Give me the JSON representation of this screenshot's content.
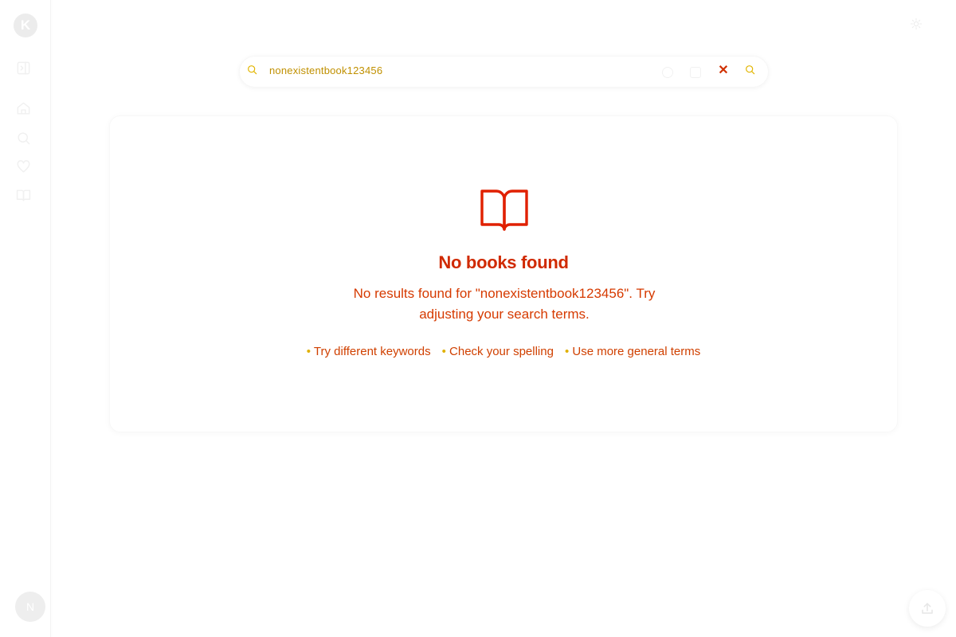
{
  "sidebar": {
    "logo_letter": "K",
    "items": [
      {
        "icon": "collapse-sidebar-icon"
      },
      {
        "icon": "home-icon"
      },
      {
        "icon": "search-icon"
      },
      {
        "icon": "heart-icon"
      },
      {
        "icon": "book-open-icon"
      }
    ],
    "avatar_letter": "N"
  },
  "header": {
    "theme_icon": "sun-icon"
  },
  "search": {
    "query": "nonexistentbook123456",
    "left_icon": "search-icon",
    "right_icon": "search-icon",
    "clear_symbol": "✕"
  },
  "empty_state": {
    "icon": "book-open-icon",
    "title": "No books found",
    "message": "No results found for \"nonexistentbook123456\". Try adjusting your search terms.",
    "tips": [
      "Try different keywords",
      "Check your spelling",
      "Use more general terms"
    ]
  },
  "fab": {
    "icon": "upload-icon"
  },
  "colors": {
    "accent": "#e02000",
    "warning": "#e2b500"
  }
}
